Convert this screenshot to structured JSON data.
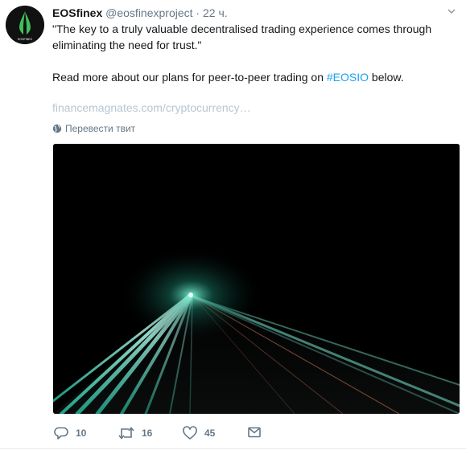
{
  "account": {
    "name": "EOSfinex",
    "handle": "@eosfinexproject",
    "separator": "·",
    "time": "22 ч.",
    "avatar_text": "EOSFINEX"
  },
  "tweet": {
    "line1": "\"The key to a truly valuable decentralised trading experience comes through eliminating the need for trust.\"",
    "line2_prefix": "Read more about our plans for peer-to-peer trading on ",
    "hashtag": "#EOSIO",
    "line2_suffix": " below.",
    "link": "financemagnates.com/cryptocurrency…",
    "translate_label": "Перевести твит"
  },
  "actions": {
    "reply_count": "10",
    "retweet_count": "16",
    "like_count": "45"
  },
  "colors": {
    "link_blue": "#1da1f2",
    "muted": "#657786",
    "logo_green": "#3fbf5b"
  },
  "icons": {
    "avatar_logo": "eosfinex-logo",
    "chevron": "chevron-down-icon",
    "globe": "globe-icon",
    "reply": "reply-icon",
    "retweet": "retweet-icon",
    "like": "heart-icon",
    "dm": "envelope-icon"
  }
}
